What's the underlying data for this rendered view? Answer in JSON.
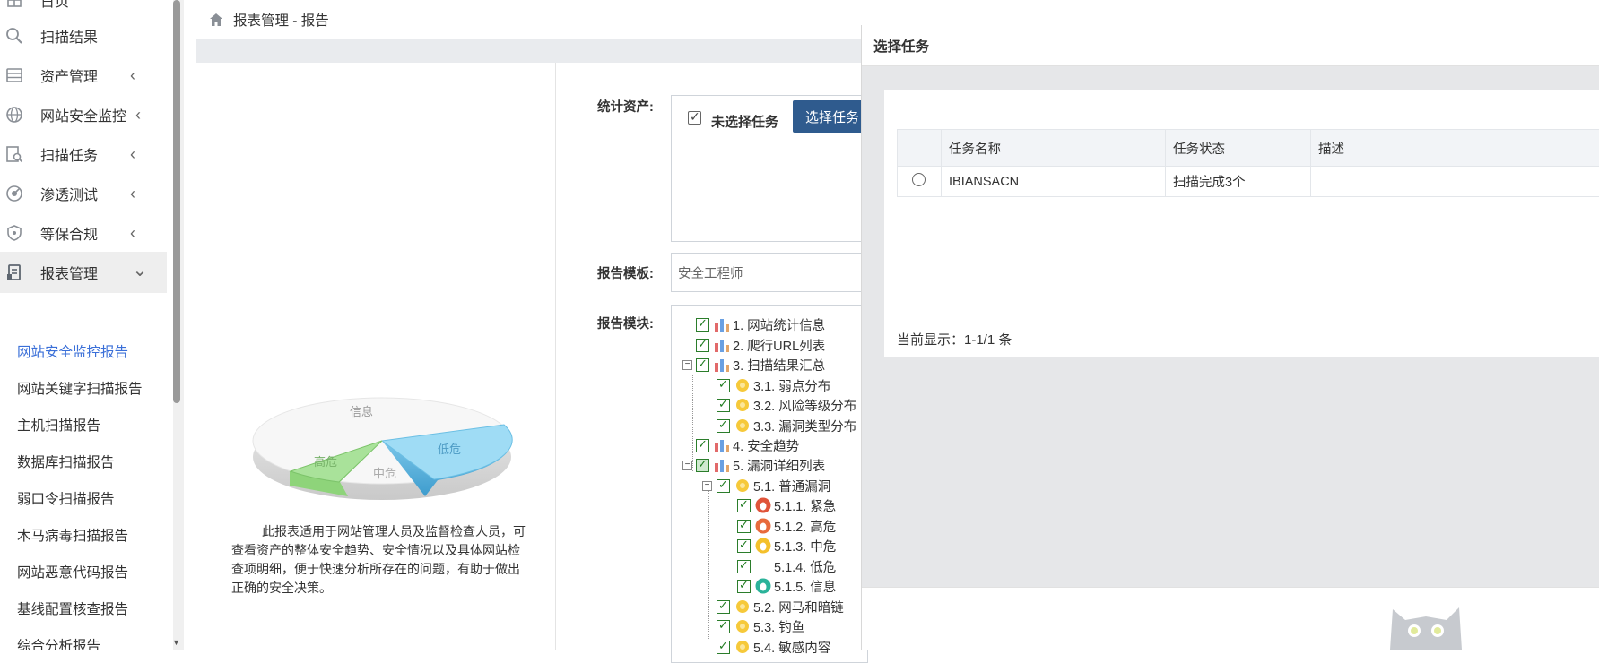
{
  "sidebar": {
    "top_item": "首页",
    "items": [
      {
        "label": "扫描结果",
        "icon": "search-icon",
        "chevron": ""
      },
      {
        "label": "资产管理",
        "icon": "server-icon",
        "chevron": "‹"
      },
      {
        "label": "网站安全监控",
        "icon": "globe-icon",
        "chevron": "‹"
      },
      {
        "label": "扫描任务",
        "icon": "scan-task-icon",
        "chevron": "‹"
      },
      {
        "label": "渗透测试",
        "icon": "target-icon",
        "chevron": "‹"
      },
      {
        "label": "等保合规",
        "icon": "shield-icon",
        "chevron": "‹"
      },
      {
        "label": "报表管理",
        "icon": "report-icon",
        "chevron": "⌄"
      }
    ],
    "sub_items": [
      "网站安全监控报告",
      "网站关键字扫描报告",
      "主机扫描报告",
      "数据库扫描报告",
      "弱口令扫描报告",
      "木马病毒扫描报告",
      "网站恶意代码报告",
      "基线配置核查报告",
      "综合分析报告"
    ]
  },
  "header": {
    "breadcrumb": "报表管理 - 报告"
  },
  "report": {
    "pie_labels": {
      "info": "信息",
      "low": "低危",
      "mid": "中危",
      "high": "高危"
    },
    "description": "此报表适用于网站管理人员及监督检查人员，可查看资产的整体安全趋势、安全情况以及具体网站检查项明细，便于快速分析所存在的问题，有助于做出正确的安全决策。",
    "stats_label": "统计资产:",
    "unselected_label": "未选择任务",
    "select_button": "选择任务",
    "template_label": "报告模板:",
    "template_value": "安全工程师",
    "modules_label": "报告模块:",
    "tree": [
      "1. 网站统计信息",
      "2. 爬行URL列表",
      "3. 扫描结果汇总",
      "3.1. 弱点分布",
      "3.2. 风险等级分布",
      "3.3. 漏洞类型分布",
      "4. 安全趋势",
      "5. 漏洞详细列表",
      "5.1. 普通漏洞",
      "5.1.1. 紧急",
      "5.1.2. 高危",
      "5.1.3. 中危",
      "5.1.4. 低危",
      "5.1.5. 信息",
      "5.2. 网马和暗链",
      "5.3. 钓鱼",
      "5.4. 敏感内容"
    ]
  },
  "modal": {
    "title": "选择任务",
    "columns": [
      "任务名称",
      "任务状态",
      "描述"
    ],
    "rows": [
      {
        "name": "IBIANSACN",
        "status": "扫描完成3个",
        "desc": ""
      }
    ],
    "paging": "当前显示：1-1/1 条"
  },
  "colors": {
    "accent_blue": "#2f5b8e",
    "active_link": "#3a6fd8",
    "tree_check": "#1e7a1e"
  }
}
